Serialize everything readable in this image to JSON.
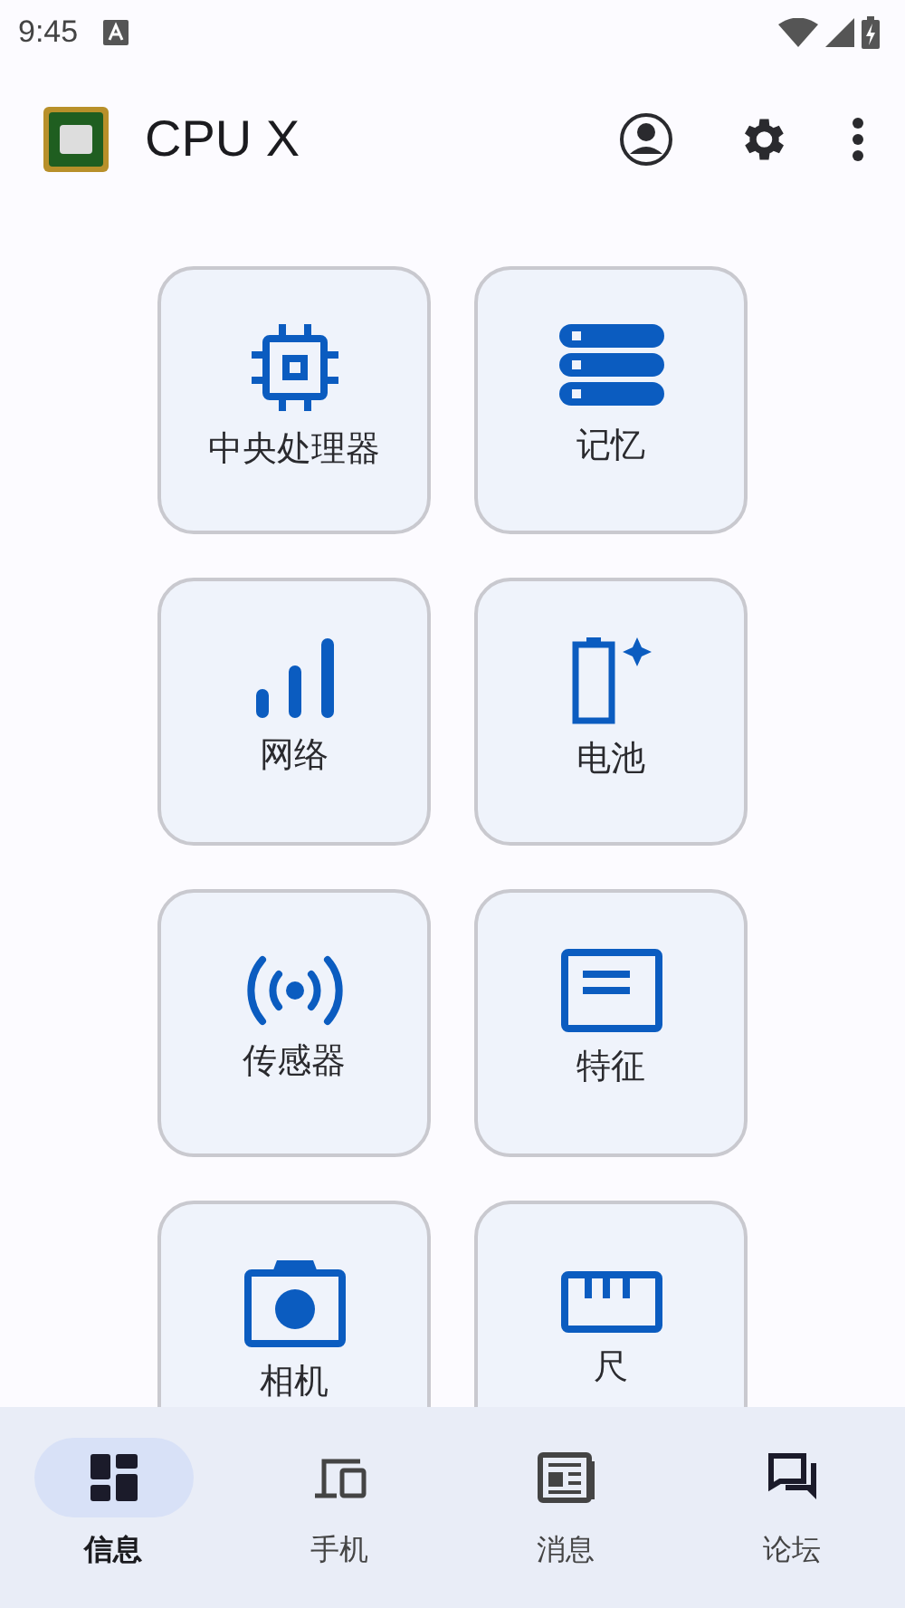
{
  "status_bar": {
    "time": "9:45"
  },
  "app_bar": {
    "title": "CPU X"
  },
  "cards": [
    {
      "kind": "cpu",
      "label": "中央处理器"
    },
    {
      "kind": "memory",
      "label": "记忆"
    },
    {
      "kind": "network",
      "label": "网络"
    },
    {
      "kind": "battery",
      "label": "电池"
    },
    {
      "kind": "sensor",
      "label": "传感器"
    },
    {
      "kind": "feature",
      "label": "特征"
    },
    {
      "kind": "camera",
      "label": "相机"
    },
    {
      "kind": "ruler",
      "label": "尺"
    }
  ],
  "bottom_nav": [
    {
      "kind": "dashboard",
      "label": "信息",
      "selected": true
    },
    {
      "kind": "devices",
      "label": "手机",
      "selected": false
    },
    {
      "kind": "news",
      "label": "消息",
      "selected": false
    },
    {
      "kind": "forum",
      "label": "论坛",
      "selected": false
    }
  ]
}
